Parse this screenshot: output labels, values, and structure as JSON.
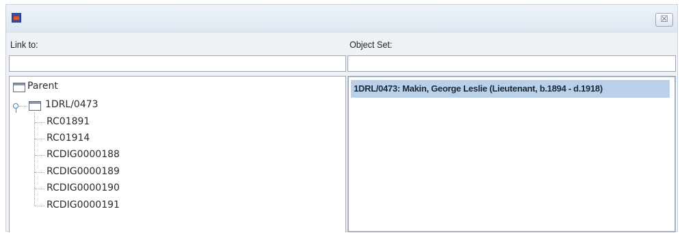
{
  "window": {
    "icon": "app-logo-icon",
    "close_icon": "close-icon",
    "close_glyph": "☒"
  },
  "link_to": {
    "label": "Link to:",
    "input_value": "",
    "tree": {
      "root": "Parent",
      "node": "1DRL/0473",
      "children": [
        "RC01891",
        "RC01914",
        "RCDIG0000188",
        "RCDIG0000189",
        "RCDIG0000190",
        "RCDIG0000191"
      ]
    }
  },
  "object_set": {
    "label": "Object Set:",
    "input_value": "",
    "items": [
      "1DRL/0473: Makin, George Leslie (Lieutenant, b.1894 - d.1918)"
    ],
    "selected_index": 0
  }
}
